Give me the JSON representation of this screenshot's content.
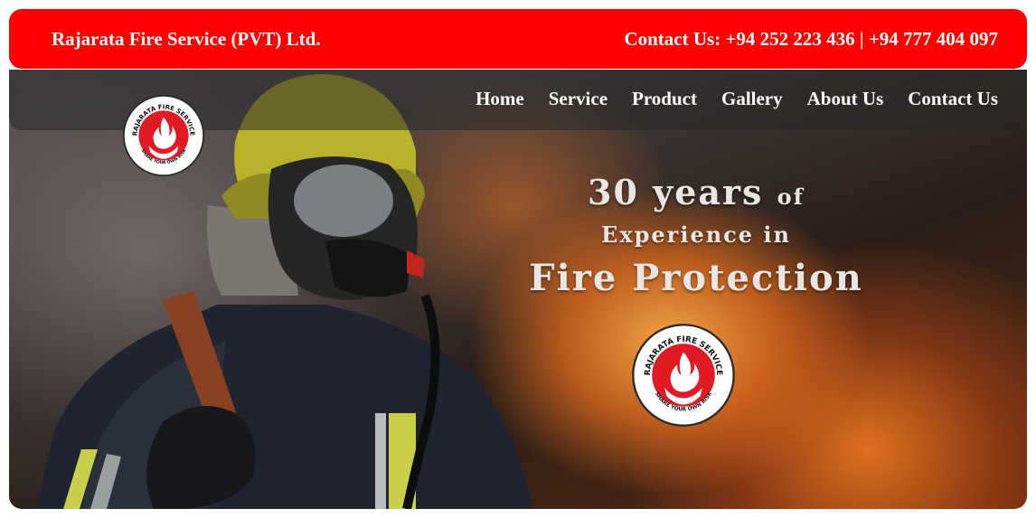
{
  "topbar": {
    "company": "Rajarata Fire Service (PVT) Ltd.",
    "contact": "Contact Us: +94 252 223 436 | +94 777 404 097"
  },
  "nav": {
    "items": [
      {
        "label": "Home"
      },
      {
        "label": "Service"
      },
      {
        "label": "Product"
      },
      {
        "label": "Gallery"
      },
      {
        "label": "About Us"
      },
      {
        "label": "Contact Us"
      }
    ]
  },
  "logo": {
    "ring_text": "RAJARATA FIRE SERVICE",
    "bottom_text": "SHARE YOUR OWN RISK"
  },
  "hero": {
    "line1_big": "30 years",
    "line1_small": "of",
    "line2": "Experience in",
    "line3": "Fire Protection"
  },
  "colors": {
    "brand_red": "#ff0000",
    "logo_red": "#e01b24",
    "headline": "#e8e6e4"
  }
}
